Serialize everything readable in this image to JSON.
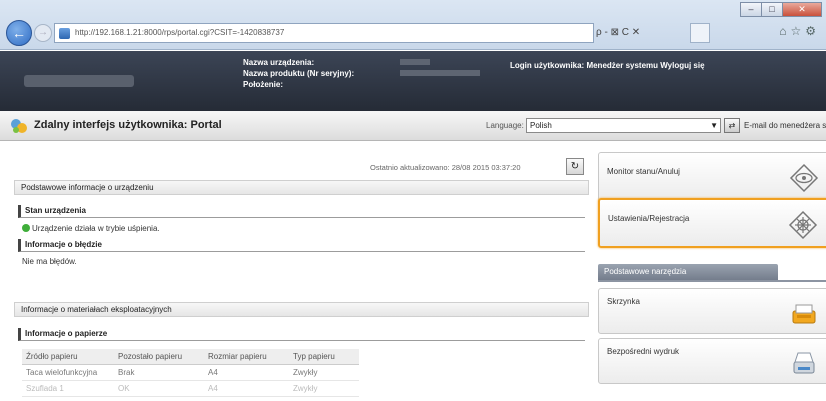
{
  "browser": {
    "url": "http://192.168.1.21:8000/rps/portal.cgi?CSIT=-1420838737",
    "address_tools": "ρ - ⊠ C ✕",
    "window_buttons": [
      "–",
      "□",
      "✕"
    ]
  },
  "header": {
    "device_name_label": "Nazwa urządzenia:",
    "product_name_label": "Nazwa produktu (Nr seryjny):",
    "location_label": "Położenie:",
    "login_text": "Login użytkownika: Menedżer systemu  Wyloguj się"
  },
  "titlebar": {
    "title": "Zdalny interfejs użytkownika: Portal",
    "language_label": "Language:",
    "language_value": "Polish",
    "email_link": "E-mail do menedżera systemu"
  },
  "main": {
    "updated_text": "Ostatnio aktualizowano: 28/08 2015 03:37:20",
    "basic_info_head": "Podstawowe informacje o urządzeniu",
    "device_status_head": "Stan urządzenia",
    "device_status_text": "Urządzenie działa w trybie uśpienia.",
    "error_info_head": "Informacje o błędzie",
    "error_info_text": "Nie ma błędów.",
    "consumables_head": "Informacje o materiałach eksploatacyjnych",
    "paper_info_head": "Informacje o papierze",
    "paper_table": {
      "headers": [
        "Źródło papieru",
        "Pozostało papieru",
        "Rozmiar papieru",
        "Typ papieru"
      ],
      "rows": [
        [
          "Taca wielofunkcyjna",
          "Brak",
          "A4",
          "Zwykły"
        ],
        [
          "Szuflada 1",
          "OK",
          "A4",
          "Zwykły"
        ]
      ]
    }
  },
  "sidebar": {
    "monitor_label": "Monitor stanu/Anuluj",
    "settings_label": "Ustawienia/Rejestracja",
    "tools_head": "Podstawowe narzędzia",
    "mailbox_label": "Skrzynka",
    "direct_print_label": "Bezpośredni wydruk"
  },
  "colors": {
    "highlight": "#f0a020",
    "status_ok": "#3fae3a",
    "header_bg": "#2b313d"
  }
}
